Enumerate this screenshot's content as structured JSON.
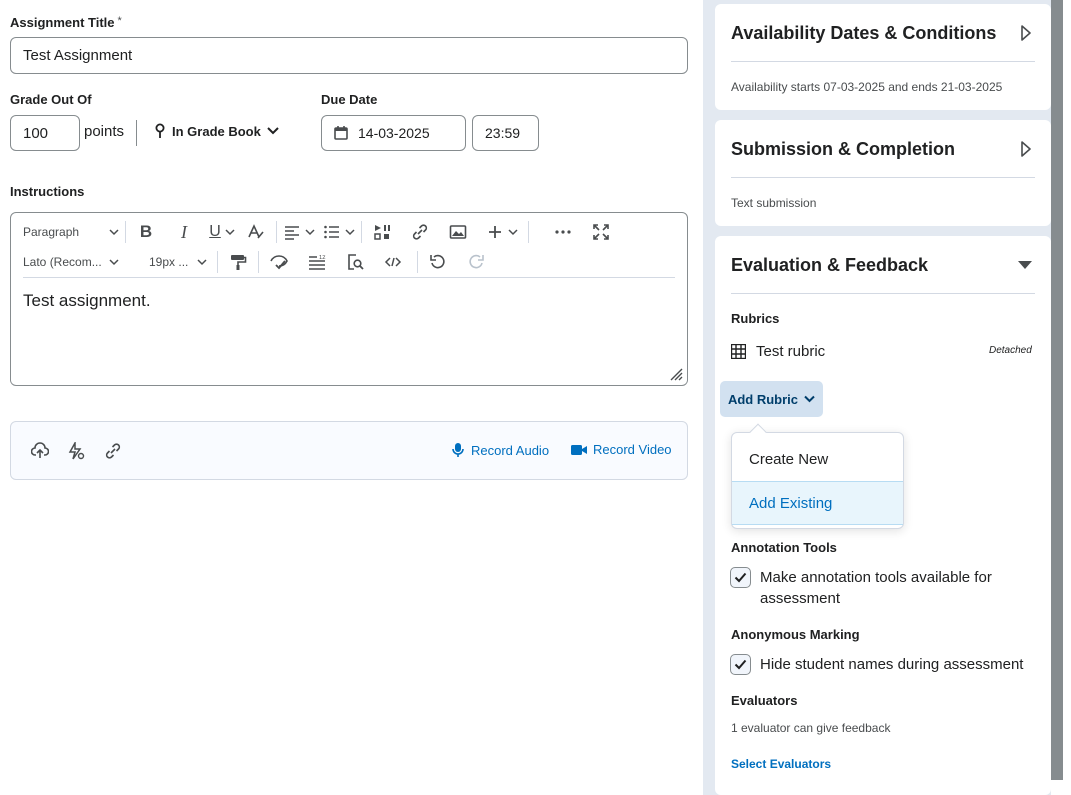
{
  "form": {
    "title_label": "Assignment Title",
    "title_required": "*",
    "title_value": "Test Assignment",
    "grade_label": "Grade Out Of",
    "grade_value": "100",
    "points_label": "points",
    "gradebook_label": "In Grade Book",
    "due_label": "Due Date",
    "due_date": "14-03-2025",
    "due_time": "23:59",
    "instructions_label": "Instructions"
  },
  "editor": {
    "paragraph_select": "Paragraph",
    "font_select": "Lato (Recom...",
    "size_select": "19px ...",
    "content": "Test assignment."
  },
  "attachments": {
    "record_audio": "Record Audio",
    "record_video": "Record Video"
  },
  "sidebar": {
    "availability": {
      "title": "Availability Dates & Conditions",
      "summary": "Availability starts 07-03-2025 and ends 21-03-2025"
    },
    "submission": {
      "title": "Submission & Completion",
      "summary": "Text submission"
    },
    "evaluation": {
      "title": "Evaluation & Feedback",
      "rubrics_label": "Rubrics",
      "rubric_name": "Test rubric",
      "rubric_status": "Detached",
      "add_rubric": "Add Rubric",
      "menu_items": [
        "Create New",
        "Add Existing"
      ],
      "annotation_label": "Annotation Tools",
      "annotation_text": "Make annotation tools available for assessment",
      "anonymous_label": "Anonymous Marking",
      "anonymous_text": "Hide student names during assessment",
      "evaluators_label": "Evaluators",
      "evaluators_text": "1 evaluator can give feedback",
      "select_evaluators": "Select Evaluators"
    }
  },
  "colors": {
    "link": "#006fbf",
    "sidebar_bg": "#e3e9f1",
    "scrollbar": "#868c8f",
    "menu_highlight": "#e8f5fc"
  }
}
